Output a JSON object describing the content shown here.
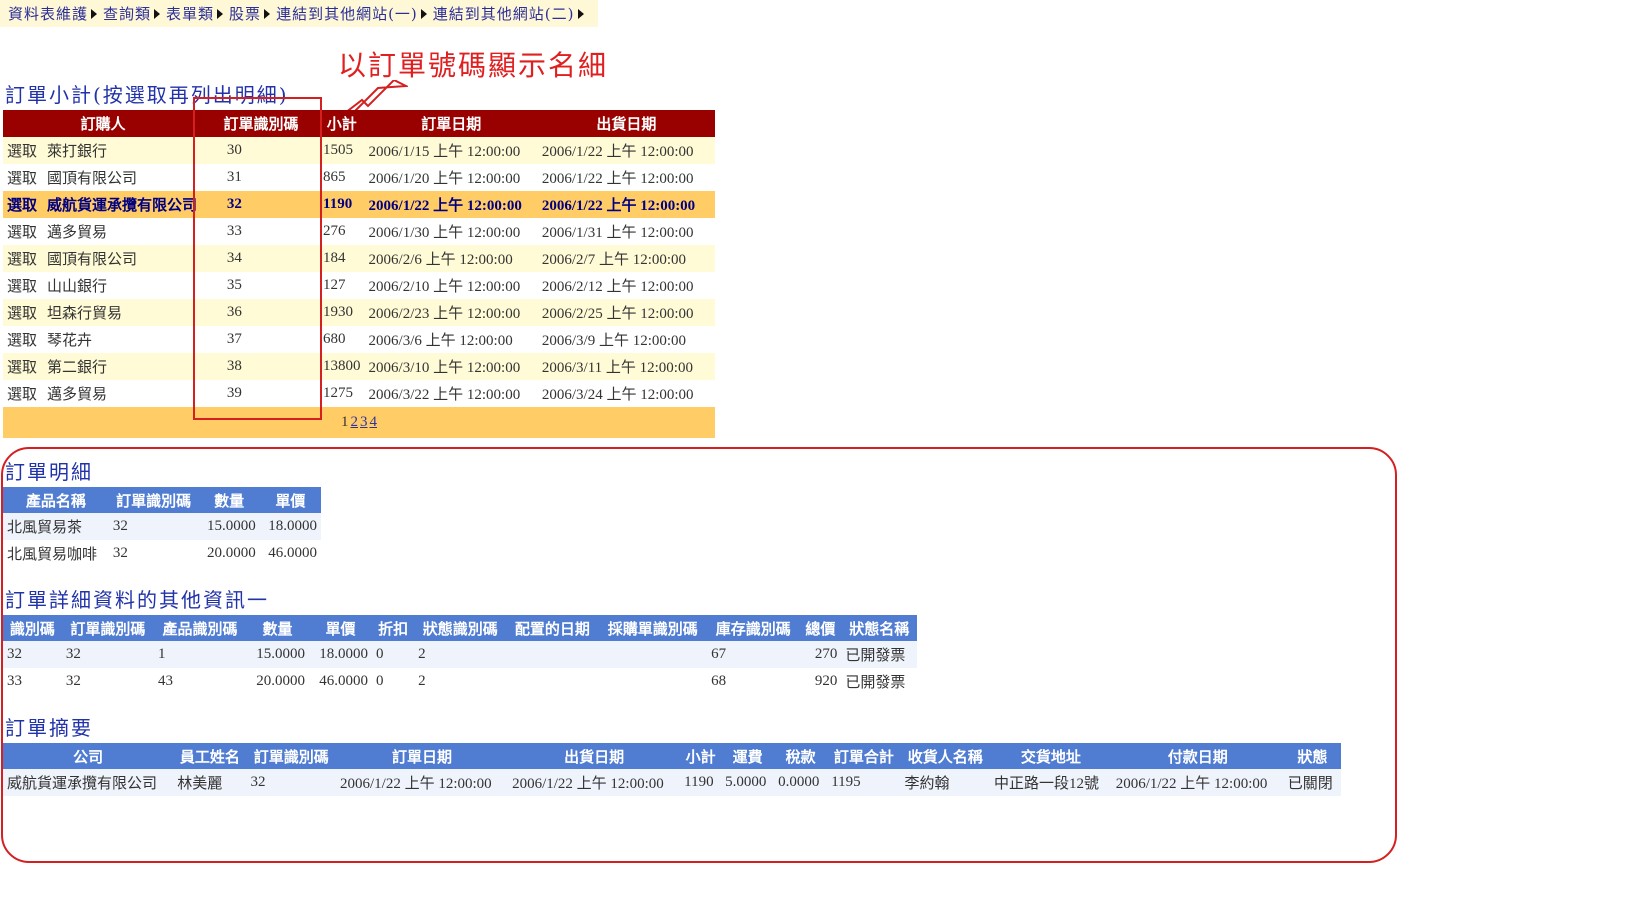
{
  "menu": [
    {
      "label": "資料表維護"
    },
    {
      "label": "查詢類"
    },
    {
      "label": "表單類"
    },
    {
      "label": "股票"
    },
    {
      "label": "連結到其他網站(一)"
    },
    {
      "label": "連結到其他網站(二)"
    }
  ],
  "annotation": {
    "text": "以訂單號碼顯示名細"
  },
  "orders": {
    "title": "訂單小計(按選取再列出明細)",
    "headers": [
      "訂購人",
      "訂單識別碼",
      "小計",
      "訂單日期",
      "出貨日期"
    ],
    "select_label": "選取",
    "rows": [
      {
        "customer": "萊打銀行",
        "id": "30",
        "subtotal": "1505",
        "order_date": "2006/1/15 上午 12:00:00",
        "ship_date": "2006/1/22 上午 12:00:00"
      },
      {
        "customer": "國頂有限公司",
        "id": "31",
        "subtotal": "865",
        "order_date": "2006/1/20 上午 12:00:00",
        "ship_date": "2006/1/22 上午 12:00:00"
      },
      {
        "customer": "威航貨運承攬有限公司",
        "id": "32",
        "subtotal": "1190",
        "order_date": "2006/1/22 上午 12:00:00",
        "ship_date": "2006/1/22 上午 12:00:00"
      },
      {
        "customer": "邁多貿易",
        "id": "33",
        "subtotal": "276",
        "order_date": "2006/1/30 上午 12:00:00",
        "ship_date": "2006/1/31 上午 12:00:00"
      },
      {
        "customer": "國頂有限公司",
        "id": "34",
        "subtotal": "184",
        "order_date": "2006/2/6 上午 12:00:00",
        "ship_date": "2006/2/7 上午 12:00:00"
      },
      {
        "customer": "山山銀行",
        "id": "35",
        "subtotal": "127",
        "order_date": "2006/2/10 上午 12:00:00",
        "ship_date": "2006/2/12 上午 12:00:00"
      },
      {
        "customer": "坦森行貿易",
        "id": "36",
        "subtotal": "1930",
        "order_date": "2006/2/23 上午 12:00:00",
        "ship_date": "2006/2/25 上午 12:00:00"
      },
      {
        "customer": "琴花卉",
        "id": "37",
        "subtotal": "680",
        "order_date": "2006/3/6 上午 12:00:00",
        "ship_date": "2006/3/9 上午 12:00:00"
      },
      {
        "customer": "第二銀行",
        "id": "38",
        "subtotal": "13800",
        "order_date": "2006/3/10 上午 12:00:00",
        "ship_date": "2006/3/11 上午 12:00:00"
      },
      {
        "customer": "邁多貿易",
        "id": "39",
        "subtotal": "1275",
        "order_date": "2006/3/22 上午 12:00:00",
        "ship_date": "2006/3/24 上午 12:00:00"
      }
    ],
    "pager": {
      "current": "1",
      "pages": [
        "2",
        "3",
        "4"
      ]
    }
  },
  "detail": {
    "title": "訂單明細",
    "headers": [
      "產品名稱",
      "訂單識別碼",
      "數量",
      "單價"
    ],
    "rows": [
      {
        "product": "北風貿易茶",
        "order_id": "32",
        "qty": "15.0000",
        "price": "18.0000"
      },
      {
        "product": "北風貿易咖啡",
        "order_id": "32",
        "qty": "20.0000",
        "price": "46.0000"
      }
    ]
  },
  "extra": {
    "title": "訂單詳細資料的其他資訊一",
    "headers": [
      "識別碼",
      "訂單識別碼",
      "產品識別碼",
      "數量",
      "單價",
      "折扣",
      "狀態識別碼",
      "配置的日期",
      "採購單識別碼",
      "庫存識別碼",
      "總價",
      "狀態名稱"
    ],
    "rows": [
      {
        "id": "32",
        "order_id": "32",
        "product_id": "1",
        "qty": "15.0000",
        "price": "18.0000",
        "discount": "0",
        "status_id": "2",
        "alloc_date": "",
        "po_id": "",
        "inv_id": "67",
        "total": "270",
        "status_name": "已開發票"
      },
      {
        "id": "33",
        "order_id": "32",
        "product_id": "43",
        "qty": "20.0000",
        "price": "46.0000",
        "discount": "0",
        "status_id": "2",
        "alloc_date": "",
        "po_id": "",
        "inv_id": "68",
        "total": "920",
        "status_name": "已開發票"
      }
    ]
  },
  "summary": {
    "title": "訂單摘要",
    "headers": [
      "公司",
      "員工姓名",
      "訂單識別碼",
      "訂單日期",
      "出貨日期",
      "小計",
      "運費",
      "稅款",
      "訂單合計",
      "收貨人名稱",
      "交貨地址",
      "付款日期",
      "狀態"
    ],
    "rows": [
      {
        "company": "威航貨運承攬有限公司",
        "employee": "林美麗",
        "order_id": "32",
        "order_date": "2006/1/22 上午 12:00:00",
        "ship_date": "2006/1/22 上午 12:00:00",
        "subtotal": "1190",
        "freight": "5.0000",
        "tax": "0.0000",
        "total": "1195",
        "recipient": "李約翰",
        "address": "中正路一段12號",
        "paid_date": "2006/1/22 上午 12:00:00",
        "status": "已關閉"
      }
    ]
  },
  "colors": {
    "menu_bg": "#fff8d6",
    "orders_header": "#990000",
    "orders_selected": "#ffcc66",
    "blue_header": "#507cd1",
    "annotation_red": "#d42020"
  }
}
